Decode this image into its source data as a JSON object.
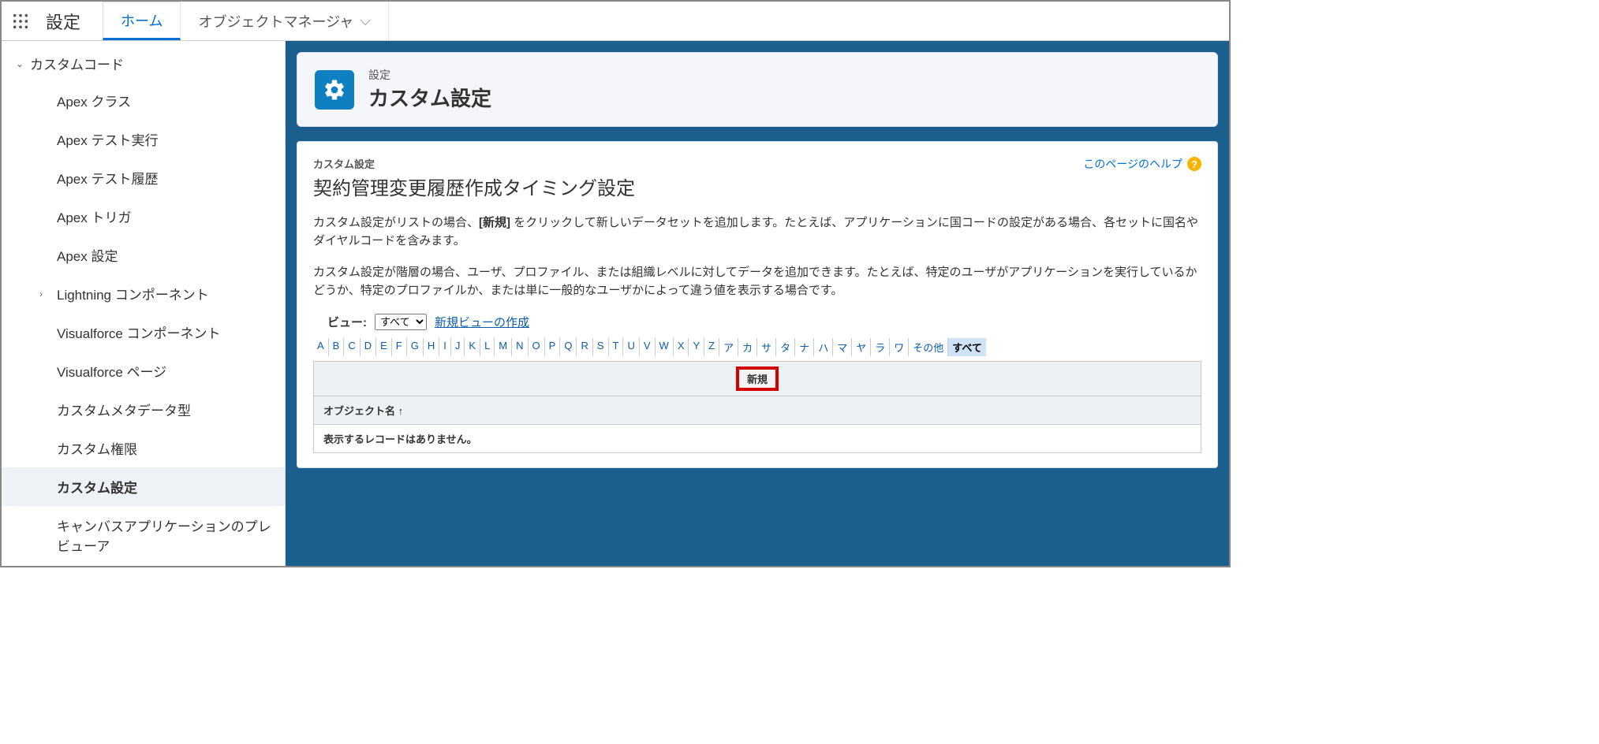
{
  "topbar": {
    "app_title": "設定",
    "tabs": [
      {
        "label": "ホーム",
        "active": true
      },
      {
        "label": "オブジェクトマネージャ",
        "dropdown": true
      }
    ]
  },
  "sidebar": {
    "group_label": "カスタムコード",
    "items": [
      {
        "label": "Apex クラス"
      },
      {
        "label": "Apex テスト実行"
      },
      {
        "label": "Apex テスト履歴"
      },
      {
        "label": "Apex トリガ"
      },
      {
        "label": "Apex 設定"
      },
      {
        "label": "Lightning コンポーネント",
        "expandable": true
      },
      {
        "label": "Visualforce コンポーネント"
      },
      {
        "label": "Visualforce ページ"
      },
      {
        "label": "カスタムメタデータ型"
      },
      {
        "label": "カスタム権限"
      },
      {
        "label": "カスタム設定",
        "selected": true
      },
      {
        "label": "キャンバスアプリケーションのプレビューア"
      }
    ]
  },
  "header": {
    "eyebrow": "設定",
    "title": "カスタム設定"
  },
  "content": {
    "crumb": "カスタム設定",
    "page_title": "契約管理変更履歴作成タイミング設定",
    "help_text": "このページのヘルプ",
    "para1_a": "カスタム設定がリストの場合、",
    "para1_b": "[新規]",
    "para1_c": " をクリックして新しいデータセットを追加します。たとえば、アプリケーションに国コードの設定がある場合、各セットに国名やダイヤルコードを含みます。",
    "para2": "カスタム設定が階層の場合、ユーザ、プロファイル、または組織レベルに対してデータを追加できます。たとえば、特定のユーザがアプリケーションを実行しているかどうか、特定のプロファイルか、または単に一般的なユーザかによって違う値を表示する場合です。",
    "view_label": "ビュー:",
    "view_option": "すべて",
    "new_view_link": "新規ビューの作成",
    "alpha": [
      "A",
      "B",
      "C",
      "D",
      "E",
      "F",
      "G",
      "H",
      "I",
      "J",
      "K",
      "L",
      "M",
      "N",
      "O",
      "P",
      "Q",
      "R",
      "S",
      "T",
      "U",
      "V",
      "W",
      "X",
      "Y",
      "Z",
      "ア",
      "カ",
      "サ",
      "タ",
      "ナ",
      "ハ",
      "マ",
      "ヤ",
      "ラ",
      "ワ",
      "その他",
      "すべて"
    ],
    "alpha_selected": "すべて",
    "new_button": "新規",
    "column_header": "オブジェクト名 ↑",
    "empty_row": "表示するレコードはありません。"
  }
}
